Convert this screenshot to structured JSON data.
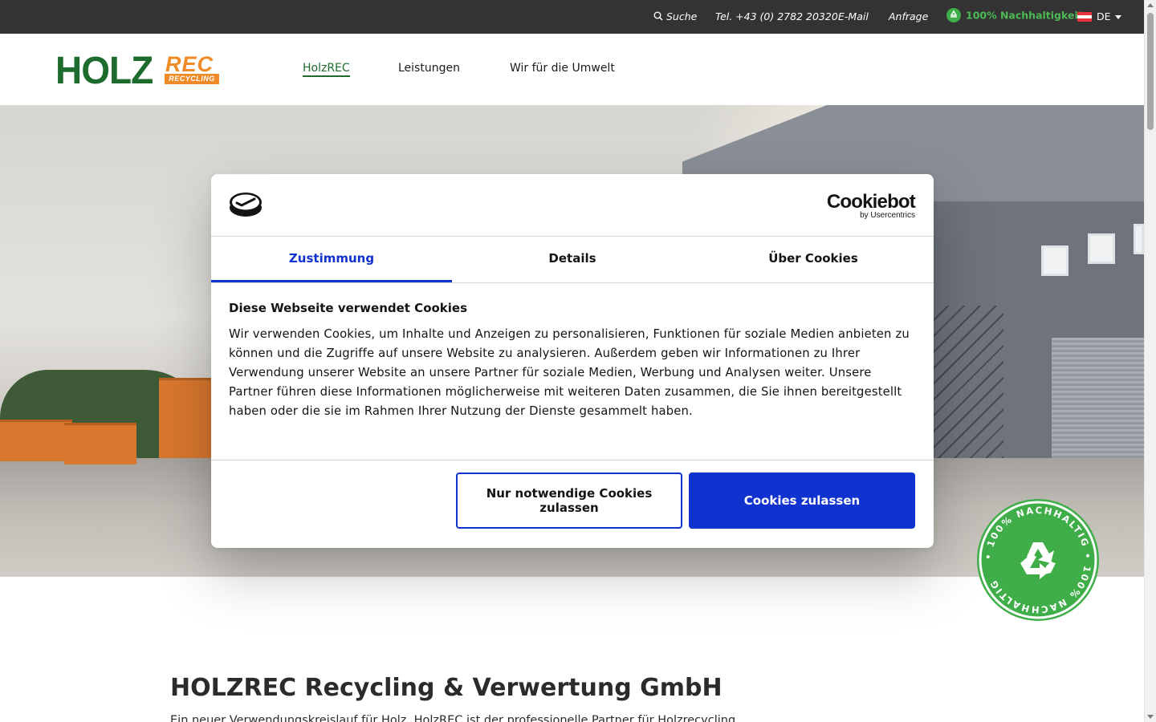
{
  "topbar": {
    "search_label": "Suche",
    "search_icon": "search-icon",
    "phone": "Tel. +43 (0) 2782 20320",
    "email": "E-Mail",
    "inquiry": "Anfrage",
    "sustainability": "100% Nachhaltigkeit",
    "language": "DE"
  },
  "header": {
    "logo_main": "HOLZ",
    "logo_accent": "REC",
    "logo_sub": "RECYCLING",
    "nav": [
      {
        "label": "HolzREC",
        "active": true
      },
      {
        "label": "Leistungen",
        "active": false
      },
      {
        "label": "Wir für die Umwelt",
        "active": false
      }
    ]
  },
  "badge": {
    "text": "100% NACHHALTIG"
  },
  "cookie_dialog": {
    "brand": "Cookiebot",
    "brand_by": "by Usercentrics",
    "tabs": [
      {
        "label": "Zustimmung",
        "active": true
      },
      {
        "label": "Details",
        "active": false
      },
      {
        "label": "Über Cookies",
        "active": false
      }
    ],
    "heading": "Diese Webseite verwendet Cookies",
    "text": "Wir verwenden Cookies, um Inhalte und Anzeigen zu personalisieren, Funktionen für soziale Medien anbieten zu können und die Zugriffe auf unsere Website zu analysieren. Außerdem geben wir Informationen zu Ihrer Verwendung unserer Website an unsere Partner für soziale Medien, Werbung und Analysen weiter. Unsere Partner führen diese Informationen möglicherweise mit weiteren Daten zusammen, die Sie ihnen bereitgestellt haben oder die sie im Rahmen Ihrer Nutzung der Dienste gesammelt haben.",
    "btn_necessary": "Nur notwendige Cookies zulassen",
    "btn_allow": "Cookies zulassen"
  },
  "content": {
    "title_bold": "HOLZREC",
    "title_rest": " Recycling & Verwertung GmbH",
    "subtitle": "Ein neuer Verwendungskreislauf für Holz. HolzREC ist der professionelle Partner für Holzrecycling."
  },
  "colors": {
    "topbar_bg": "#333333",
    "brand_green": "#1e6b2e",
    "brand_orange": "#f08a24",
    "cookiebot_blue": "#1032cf",
    "badge_green": "#3fae49"
  }
}
